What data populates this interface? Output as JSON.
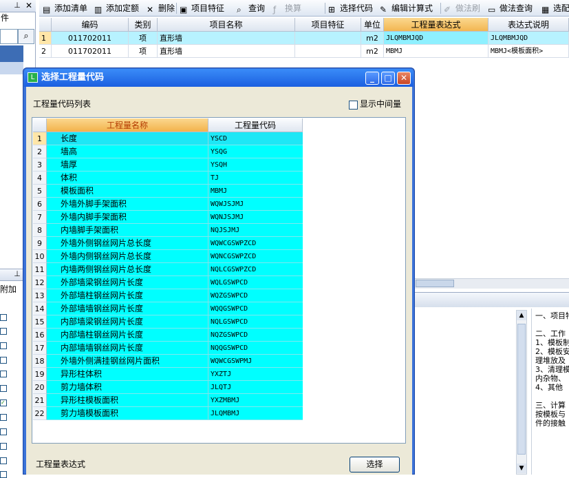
{
  "left_panel": {
    "pin_icon": "pin-icon",
    "close_icon": "close-icon",
    "partial_text": "件",
    "search_icon": "search-icon",
    "second_panel_text": "附加"
  },
  "toolbar": {
    "items": [
      {
        "label": "添加清单",
        "icon": "add-list-icon",
        "enabled": true
      },
      {
        "label": "添加定额",
        "icon": "add-quota-icon",
        "enabled": true
      },
      {
        "label": "删除",
        "icon": "delete-icon",
        "enabled": true
      },
      {
        "label": "项目特征",
        "icon": "feature-icon",
        "enabled": true
      },
      {
        "label": "查询",
        "icon": "search-icon",
        "enabled": true
      },
      {
        "label": "换算",
        "icon": "formula-icon",
        "enabled": false
      },
      {
        "label": "选择代码",
        "icon": "select-code-icon",
        "enabled": true
      },
      {
        "label": "编辑计算式",
        "icon": "edit-formula-icon",
        "enabled": true
      },
      {
        "label": "做法刷",
        "icon": "brush-icon",
        "enabled": false
      },
      {
        "label": "做法查询",
        "icon": "query-icon",
        "enabled": true
      },
      {
        "label": "选配",
        "icon": "match-icon",
        "enabled": true
      }
    ]
  },
  "main_grid": {
    "columns": [
      "编码",
      "类别",
      "项目名称",
      "项目特征",
      "单位",
      "工程量表达式",
      "表达式说明"
    ],
    "rows": [
      {
        "num": "1",
        "code": "011702011",
        "type": "项",
        "name": "直形墙",
        "feature": "",
        "unit": "m2",
        "expr": "JLQMBMJQD",
        "desc": "JLQMBMJQD"
      },
      {
        "num": "2",
        "code": "011702011",
        "type": "项",
        "name": "直形墙",
        "feature": "",
        "unit": "m2",
        "expr": "MBMJ",
        "desc": "MBMJ<模板面积>"
      }
    ]
  },
  "notes_panel": {
    "lines": [
      "一、项目特",
      "",
      "二、工作",
      "1、模板制",
      "2、模板安",
      "理堆放及",
      "3、清理模",
      "内杂物、",
      "4、其他",
      "",
      "三、计算",
      "  按模板与",
      "件的接触"
    ]
  },
  "dialog": {
    "title": "选择工程量代码",
    "list_label": "工程量代码列表",
    "show_intermediate_label": "显示中间量",
    "show_intermediate_checked": false,
    "columns": [
      "工程量名称",
      "工程量代码"
    ],
    "rows": [
      {
        "num": "1",
        "name": "长度",
        "code": "YSCD"
      },
      {
        "num": "2",
        "name": "墙高",
        "code": "YSQG"
      },
      {
        "num": "3",
        "name": "墙厚",
        "code": "YSQH"
      },
      {
        "num": "4",
        "name": "体积",
        "code": "TJ"
      },
      {
        "num": "5",
        "name": "模板面积",
        "code": "MBMJ"
      },
      {
        "num": "6",
        "name": "外墙外脚手架面积",
        "code": "WQWJSJMJ"
      },
      {
        "num": "7",
        "name": "外墙内脚手架面积",
        "code": "WQNJSJMJ"
      },
      {
        "num": "8",
        "name": "内墙脚手架面积",
        "code": "NQJSJMJ"
      },
      {
        "num": "9",
        "name": "外墙外侧钢丝网片总长度",
        "code": "WQWCGSWPZCD"
      },
      {
        "num": "10",
        "name": "外墙内侧钢丝网片总长度",
        "code": "WQNCGSWPZCD"
      },
      {
        "num": "11",
        "name": "内墙两侧钢丝网片总长度",
        "code": "NQLCGSWPZCD"
      },
      {
        "num": "12",
        "name": "外部墙梁钢丝网片长度",
        "code": "WQLGSWPCD"
      },
      {
        "num": "13",
        "name": "外部墙柱钢丝网片长度",
        "code": "WQZGSWPCD"
      },
      {
        "num": "14",
        "name": "外部墙墙钢丝网片长度",
        "code": "WQQGSWPCD"
      },
      {
        "num": "15",
        "name": "内部墙梁钢丝网片长度",
        "code": "NQLGSWPCD"
      },
      {
        "num": "16",
        "name": "内部墙柱钢丝网片长度",
        "code": "NQZGSWPCD"
      },
      {
        "num": "17",
        "name": "内部墙墙钢丝网片长度",
        "code": "NQQGSWPCD"
      },
      {
        "num": "18",
        "name": "外墙外侧满挂钢丝网片面积",
        "code": "WQWCGSWPMJ"
      },
      {
        "num": "19",
        "name": "异形柱体积",
        "code": "YXZTJ"
      },
      {
        "num": "20",
        "name": "剪力墙体积",
        "code": "JLQTJ"
      },
      {
        "num": "21",
        "name": "异形柱模板面积",
        "code": "YXZMBMJ"
      },
      {
        "num": "22",
        "name": "剪力墙模板面积",
        "code": "JLQMBMJ"
      }
    ],
    "selected_row": "1",
    "expr_label": "工程量表达式",
    "select_button": "选择"
  }
}
